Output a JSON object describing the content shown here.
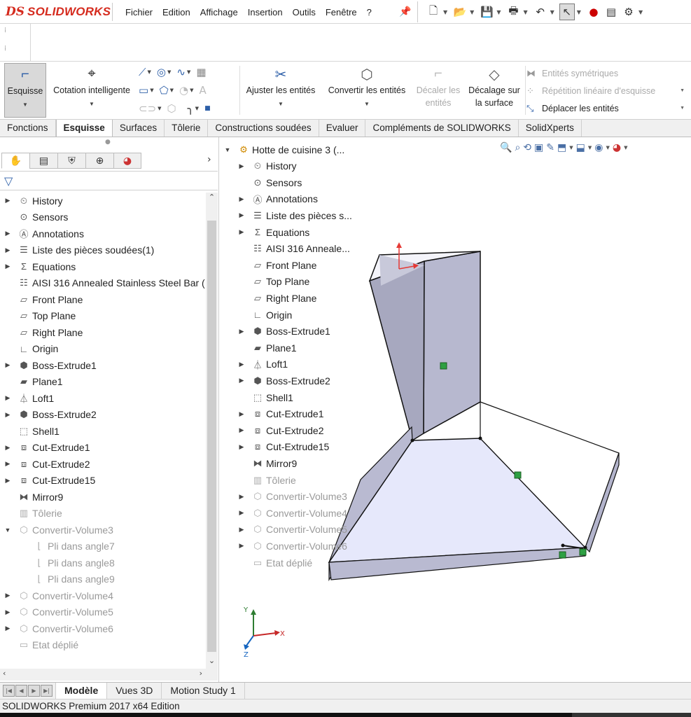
{
  "app": {
    "logo_ds": "DS",
    "logo_name": "SOLIDWORKS"
  },
  "menus": [
    "Fichier",
    "Edition",
    "Affichage",
    "Insertion",
    "Outils",
    "Fenêtre",
    "?"
  ],
  "command_manager": {
    "esquisse": "Esquisse",
    "cotation": "Cotation intelligente",
    "ajuster": "Ajuster les entités",
    "convertir": "Convertir les entités",
    "decaler_line1": "Décaler les",
    "decaler_line2": "entités",
    "decalage_line1": "Décalage sur",
    "decalage_line2": "la surface",
    "symetriques": "Entités symétriques",
    "repetition": "Répétition linéaire d'esquisse",
    "deplacer": "Déplacer les entités"
  },
  "tabs": [
    {
      "label": "Fonctions",
      "active": false
    },
    {
      "label": "Esquisse",
      "active": true
    },
    {
      "label": "Surfaces",
      "active": false
    },
    {
      "label": "Tôlerie",
      "active": false
    },
    {
      "label": "Constructions soudées",
      "active": false
    },
    {
      "label": "Evaluer",
      "active": false
    },
    {
      "label": "Compléments de SOLIDWORKS",
      "active": false
    },
    {
      "label": "SolidXperts",
      "active": false
    }
  ],
  "feature_tree": [
    {
      "label": "History",
      "icon": "history-icon",
      "arrow": true,
      "dim": false,
      "child": false
    },
    {
      "label": "Sensors",
      "icon": "sensors-icon",
      "arrow": false,
      "dim": false,
      "child": false
    },
    {
      "label": "Annotations",
      "icon": "annotations-icon",
      "arrow": true,
      "dim": false,
      "child": false
    },
    {
      "label": "Liste des pièces soudées(1)",
      "icon": "cut-list-icon",
      "arrow": true,
      "dim": false,
      "child": false
    },
    {
      "label": "Equations",
      "icon": "equations-icon",
      "arrow": true,
      "dim": false,
      "child": false
    },
    {
      "label": "AISI 316 Annealed Stainless Steel Bar (",
      "icon": "material-icon",
      "arrow": false,
      "dim": false,
      "child": false
    },
    {
      "label": "Front Plane",
      "icon": "plane-icon",
      "arrow": false,
      "dim": false,
      "child": false
    },
    {
      "label": "Top Plane",
      "icon": "plane-icon",
      "arrow": false,
      "dim": false,
      "child": false
    },
    {
      "label": "Right Plane",
      "icon": "plane-icon",
      "arrow": false,
      "dim": false,
      "child": false
    },
    {
      "label": "Origin",
      "icon": "origin-icon",
      "arrow": false,
      "dim": false,
      "child": false
    },
    {
      "label": "Boss-Extrude1",
      "icon": "extrude-icon",
      "arrow": true,
      "dim": false,
      "child": false
    },
    {
      "label": "Plane1",
      "icon": "plane1-icon",
      "arrow": false,
      "dim": false,
      "child": false
    },
    {
      "label": "Loft1",
      "icon": "loft-icon",
      "arrow": true,
      "dim": false,
      "child": false
    },
    {
      "label": "Boss-Extrude2",
      "icon": "extrude-icon",
      "arrow": true,
      "dim": false,
      "child": false
    },
    {
      "label": "Shell1",
      "icon": "shell-icon",
      "arrow": false,
      "dim": false,
      "child": false
    },
    {
      "label": "Cut-Extrude1",
      "icon": "cut-extrude-icon",
      "arrow": true,
      "dim": false,
      "child": false
    },
    {
      "label": "Cut-Extrude2",
      "icon": "cut-extrude-icon",
      "arrow": true,
      "dim": false,
      "child": false
    },
    {
      "label": "Cut-Extrude15",
      "icon": "cut-extrude-icon",
      "arrow": true,
      "dim": false,
      "child": false
    },
    {
      "label": "Mirror9",
      "icon": "mirror-icon",
      "arrow": false,
      "dim": false,
      "child": false
    },
    {
      "label": "Tôlerie",
      "icon": "sheet-metal-icon",
      "arrow": false,
      "dim": true,
      "child": false
    },
    {
      "label": "Convertir-Volume3",
      "icon": "convert-icon",
      "arrow": true,
      "dim": true,
      "child": false,
      "open": true
    },
    {
      "label": "Pli dans angle7",
      "icon": "bend-icon",
      "arrow": false,
      "dim": true,
      "child": true
    },
    {
      "label": "Pli dans angle8",
      "icon": "bend-icon",
      "arrow": false,
      "dim": true,
      "child": true
    },
    {
      "label": "Pli dans angle9",
      "icon": "bend-icon",
      "arrow": false,
      "dim": true,
      "child": true
    },
    {
      "label": "Convertir-Volume4",
      "icon": "convert-icon",
      "arrow": true,
      "dim": true,
      "child": false
    },
    {
      "label": "Convertir-Volume5",
      "icon": "convert-icon",
      "arrow": true,
      "dim": true,
      "child": false
    },
    {
      "label": "Convertir-Volume6",
      "icon": "convert-icon",
      "arrow": true,
      "dim": true,
      "child": false
    },
    {
      "label": "Etat déplié",
      "icon": "flat-pattern-icon",
      "arrow": false,
      "dim": true,
      "child": false
    }
  ],
  "viewport_tree": {
    "root": "Hotte de cuisine 3  (...",
    "items": [
      {
        "label": "History",
        "icon": "history-icon",
        "arrow": true,
        "dim": false
      },
      {
        "label": "Sensors",
        "icon": "sensors-icon",
        "arrow": false,
        "dim": false
      },
      {
        "label": "Annotations",
        "icon": "annotations-icon",
        "arrow": true,
        "dim": false
      },
      {
        "label": "Liste des pièces s...",
        "icon": "cut-list-icon",
        "arrow": true,
        "dim": false
      },
      {
        "label": "Equations",
        "icon": "equations-icon",
        "arrow": true,
        "dim": false
      },
      {
        "label": "AISI 316 Anneale...",
        "icon": "material-icon",
        "arrow": false,
        "dim": false
      },
      {
        "label": "Front Plane",
        "icon": "plane-icon",
        "arrow": false,
        "dim": false
      },
      {
        "label": "Top Plane",
        "icon": "plane-icon",
        "arrow": false,
        "dim": false
      },
      {
        "label": "Right Plane",
        "icon": "plane-icon",
        "arrow": false,
        "dim": false
      },
      {
        "label": "Origin",
        "icon": "origin-icon",
        "arrow": false,
        "dim": false
      },
      {
        "label": "Boss-Extrude1",
        "icon": "extrude-icon",
        "arrow": true,
        "dim": false
      },
      {
        "label": "Plane1",
        "icon": "plane1-icon",
        "arrow": false,
        "dim": false
      },
      {
        "label": "Loft1",
        "icon": "loft-icon",
        "arrow": true,
        "dim": false
      },
      {
        "label": "Boss-Extrude2",
        "icon": "extrude-icon",
        "arrow": true,
        "dim": false
      },
      {
        "label": "Shell1",
        "icon": "shell-icon",
        "arrow": false,
        "dim": false
      },
      {
        "label": "Cut-Extrude1",
        "icon": "cut-extrude-icon",
        "arrow": true,
        "dim": false
      },
      {
        "label": "Cut-Extrude2",
        "icon": "cut-extrude-icon",
        "arrow": true,
        "dim": false
      },
      {
        "label": "Cut-Extrude15",
        "icon": "cut-extrude-icon",
        "arrow": true,
        "dim": false
      },
      {
        "label": "Mirror9",
        "icon": "mirror-icon",
        "arrow": false,
        "dim": false
      },
      {
        "label": "Tôlerie",
        "icon": "sheet-metal-icon",
        "arrow": false,
        "dim": true
      },
      {
        "label": "Convertir-Volume3",
        "icon": "convert-icon",
        "arrow": true,
        "dim": true
      },
      {
        "label": "Convertir-Volume4",
        "icon": "convert-icon",
        "arrow": true,
        "dim": true
      },
      {
        "label": "Convertir-Volume5",
        "icon": "convert-icon",
        "arrow": true,
        "dim": true
      },
      {
        "label": "Convertir-Volume6",
        "icon": "convert-icon",
        "arrow": true,
        "dim": true
      },
      {
        "label": "Etat déplié",
        "icon": "flat-pattern-icon",
        "arrow": false,
        "dim": true
      }
    ]
  },
  "triad": {
    "x": "X",
    "y": "Y",
    "z": "Z"
  },
  "bottom_tabs": [
    {
      "label": "Modèle",
      "active": true
    },
    {
      "label": "Vues 3D",
      "active": false
    },
    {
      "label": "Motion Study 1",
      "active": false
    }
  ],
  "status": "SOLIDWORKS Premium 2017 x64 Edition",
  "colors": {
    "brand": "#d52b1e",
    "accent": "#2d5fa8",
    "model_face": "#e6e8fb",
    "model_side": "#b9bad1",
    "model_edge": "#111111"
  }
}
